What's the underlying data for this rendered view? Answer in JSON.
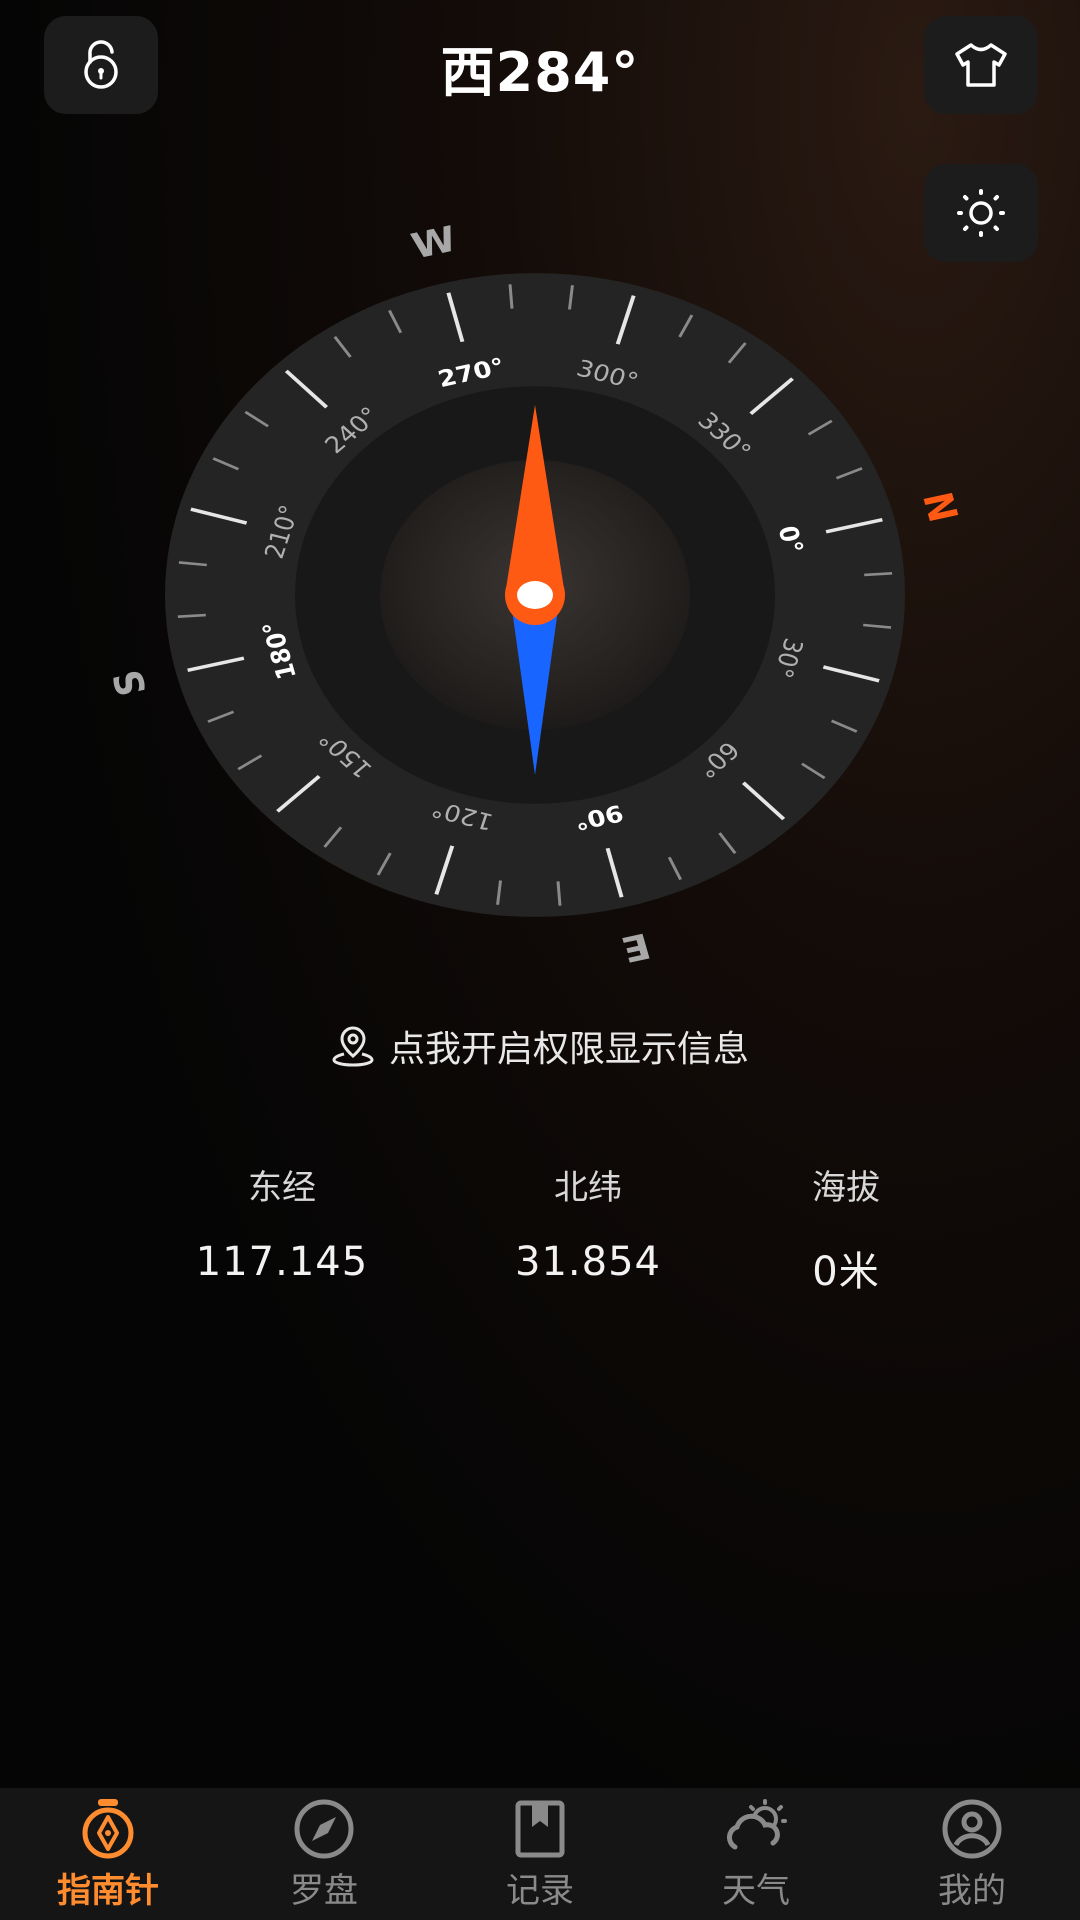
{
  "header": {
    "title": "西284°"
  },
  "compass": {
    "heading_deg": 284,
    "cardinals": [
      "N",
      "E",
      "S",
      "W"
    ],
    "degree_labels": [
      "0°",
      "30°",
      "60°",
      "90°",
      "120°",
      "150°",
      "180°",
      "210°",
      "240°",
      "270°",
      "300°",
      "330°"
    ]
  },
  "permission": {
    "text": "点我开启权限显示信息"
  },
  "stats": [
    {
      "label": "东经",
      "value": "117.145"
    },
    {
      "label": "北纬",
      "value": "31.854"
    },
    {
      "label": "海拔",
      "value": "0米"
    }
  ],
  "tabs": [
    {
      "label": "指南针",
      "icon": "compass-pin-icon",
      "active": true
    },
    {
      "label": "罗盘",
      "icon": "compass-icon",
      "active": false
    },
    {
      "label": "记录",
      "icon": "bookmark-icon",
      "active": false
    },
    {
      "label": "天气",
      "icon": "weather-icon",
      "active": false
    },
    {
      "label": "我的",
      "icon": "user-icon",
      "active": false
    }
  ],
  "colors": {
    "accent": "#ff8c2e",
    "needle_north": "#ff5a14",
    "needle_south": "#1866ff",
    "north_label": "#ff5a14"
  }
}
